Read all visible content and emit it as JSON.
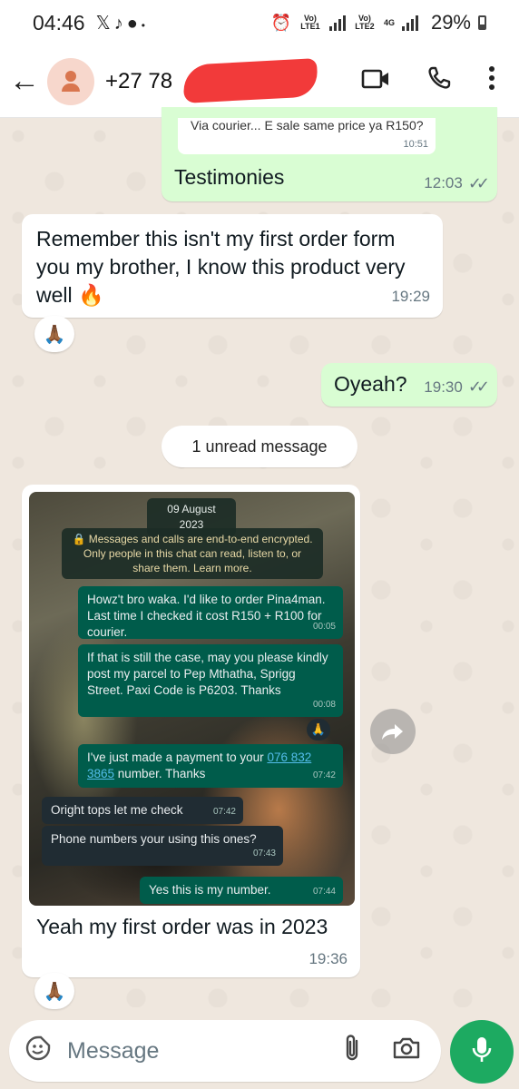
{
  "status_bar": {
    "time": "04:46",
    "left_icons": [
      "x-icon",
      "music-icon",
      "chat-icon",
      "dot-icon"
    ],
    "net1": "Vo) LTE1",
    "net2": "Vo) LTE2",
    "net_type": "4G",
    "battery": "29%"
  },
  "header": {
    "contact": "+27 78",
    "actions": [
      "video-call-icon",
      "voice-call-icon",
      "menu-icon"
    ]
  },
  "messages": [
    {
      "id": "quoted",
      "text": "Via courier... E sale same price ya R150?",
      "time": "10:51"
    },
    {
      "id": "testimonies",
      "direction": "out",
      "text": "Testimonies",
      "time": "12:03",
      "status": "read"
    },
    {
      "id": "remember",
      "direction": "in",
      "text": "Remember this isn't my first order form you my brother, I know this product very well 🔥",
      "time": "19:29",
      "reaction": "🙏🏾"
    },
    {
      "id": "oyeah",
      "direction": "out",
      "text": "Oyeah?",
      "time": "19:30",
      "status": "read"
    }
  ],
  "unread_label": "1 unread message",
  "image_message": {
    "caption": "Yeah my first order was in 2023",
    "time": "19:36",
    "reaction": "🙏🏾",
    "screenshot": {
      "date_chip": "09 August 2023",
      "encryption": "🔒 Messages and calls are end-to-end encrypted. Only people in this chat can read, listen to, or share them. Learn more.",
      "msgs": [
        {
          "dir": "out",
          "text": "Howz't bro waka. I'd like to order Pina4man. Last time I checked it cost R150 + R100 for courier.",
          "time": "00:05"
        },
        {
          "dir": "out",
          "text": "If that is still the case, may you please kindly post my parcel to Pep Mthatha, Sprigg Street. Paxi Code is P6203. Thanks",
          "time": "00:08"
        },
        {
          "dir": "out",
          "text_before": "I've just made a payment to your ",
          "link": "076 832 3865",
          "text_after": " number. Thanks",
          "time": "07:42"
        },
        {
          "dir": "in",
          "text": "Oright tops let me check",
          "time": "07:42"
        },
        {
          "dir": "in",
          "text": "Phone numbers your using this ones?",
          "time": "07:43"
        },
        {
          "dir": "out",
          "text": "Yes this is my number.",
          "time": "07:44"
        }
      ],
      "mini_reaction": "🙏"
    }
  },
  "composer": {
    "placeholder": "Message",
    "icons": [
      "sticker-icon",
      "attach-icon",
      "camera-icon",
      "mic-icon"
    ]
  },
  "colors": {
    "outgoing_bubble": "#d9fdd3",
    "incoming_bubble": "#ffffff",
    "background": "#efe7de",
    "mic_button": "#1daa61",
    "redaction": "#f23a3a"
  }
}
